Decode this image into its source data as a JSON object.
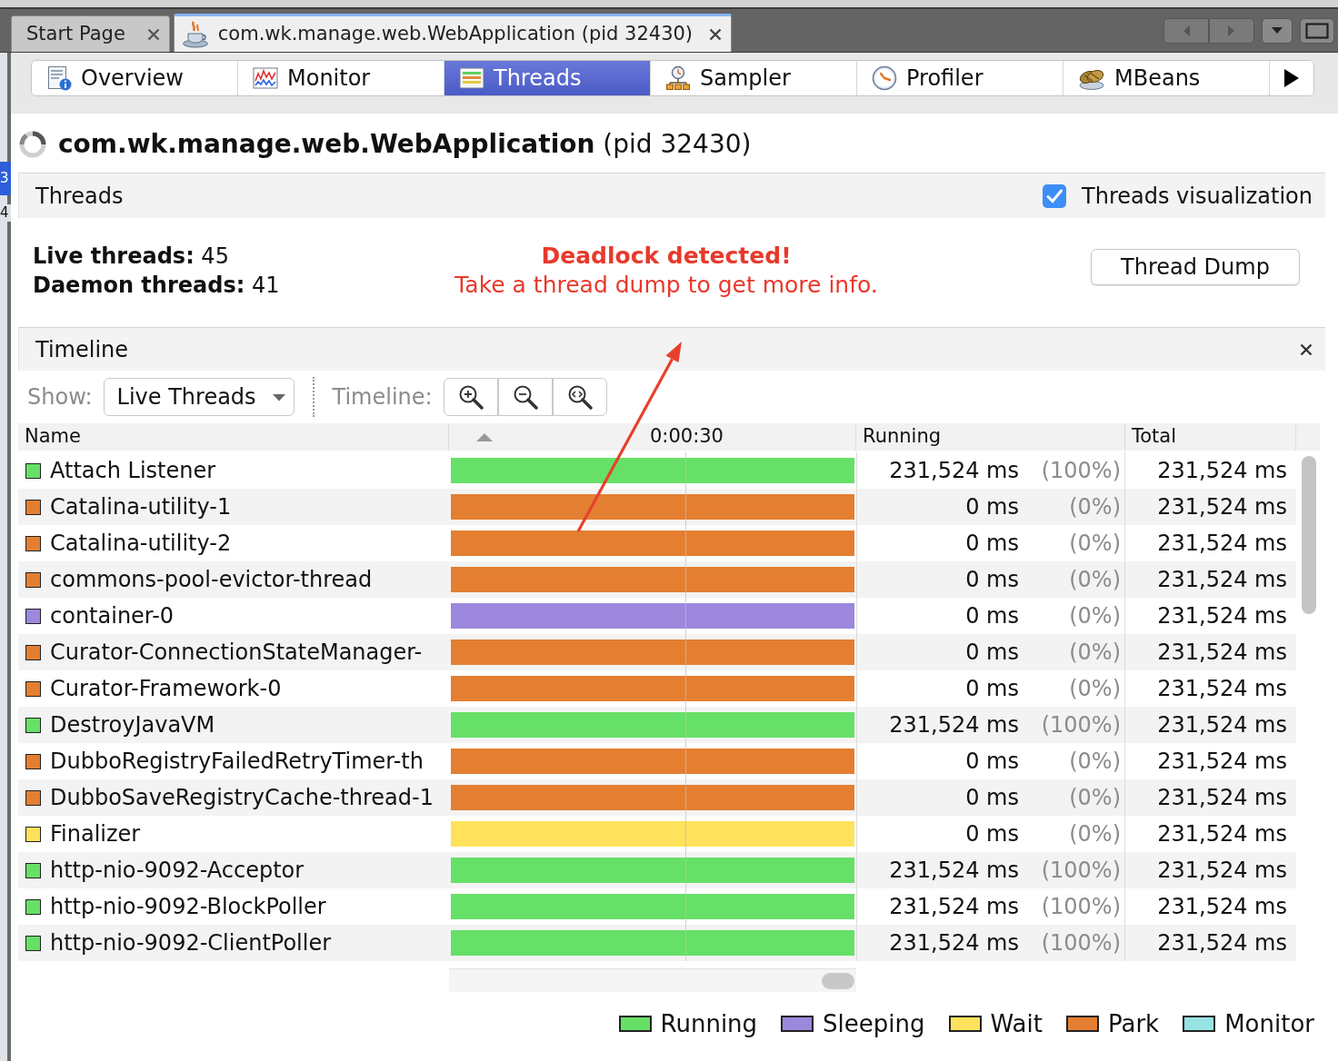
{
  "document_tabs": [
    {
      "label": "Start Page",
      "selected": false
    },
    {
      "label": "com.wk.manage.web.WebApplication (pid 32430)",
      "selected": true
    }
  ],
  "edge_fragment": [
    {
      "text": "3",
      "selected": true
    },
    {
      "text": "4",
      "selected": false
    }
  ],
  "view_tabs": [
    {
      "label": "Overview",
      "selected": false
    },
    {
      "label": "Monitor",
      "selected": false
    },
    {
      "label": "Threads",
      "selected": true
    },
    {
      "label": "Sampler",
      "selected": false
    },
    {
      "label": "Profiler",
      "selected": false
    },
    {
      "label": "MBeans",
      "selected": false
    }
  ],
  "app_title": "**com.wk.manage.web.WebApplication** (pid 32430)",
  "threads_section": {
    "title": "Threads",
    "visualization": {
      "label": "Threads visualization",
      "checked": true
    },
    "stats": [
      "**Live threads:** 45",
      "**Daemon threads:** 41"
    ],
    "alert": {
      "title": "Deadlock detected!",
      "message": "Take a thread dump to get more info."
    },
    "dump_button": "Thread Dump"
  },
  "timeline_section": {
    "title": "Timeline",
    "show_label": "Show:",
    "show_value": "Live Threads",
    "timeline_label": "Timeline:"
  },
  "table": {
    "columns": {
      "name": "Name",
      "timeline_tick": "0:00:30",
      "running": "Running",
      "total": "Total"
    },
    "rows": [
      {
        "name": "Attach Listener",
        "color": "#66e066",
        "running": "231,524 ms",
        "running_share": "(100%)",
        "total": "231,524 ms"
      },
      {
        "name": "Catalina-utility-1",
        "color": "#e47f31",
        "running": "0 ms",
        "running_share": "(0%)",
        "total": "231,524 ms"
      },
      {
        "name": "Catalina-utility-2",
        "color": "#e47f31",
        "running": "0 ms",
        "running_share": "(0%)",
        "total": "231,524 ms"
      },
      {
        "name": "commons-pool-evictor-thread",
        "color": "#e47f31",
        "running": "0 ms",
        "running_share": "(0%)",
        "total": "231,524 ms"
      },
      {
        "name": "container-0",
        "color": "#9c88dc",
        "running": "0 ms",
        "running_share": "(0%)",
        "total": "231,524 ms"
      },
      {
        "name": "Curator-ConnectionStateManager-",
        "color": "#e47f31",
        "running": "0 ms",
        "running_share": "(0%)",
        "total": "231,524 ms"
      },
      {
        "name": "Curator-Framework-0",
        "color": "#e47f31",
        "running": "0 ms",
        "running_share": "(0%)",
        "total": "231,524 ms"
      },
      {
        "name": "DestroyJavaVM",
        "color": "#66e066",
        "running": "231,524 ms",
        "running_share": "(100%)",
        "total": "231,524 ms"
      },
      {
        "name": "DubboRegistryFailedRetryTimer-th",
        "color": "#e47f31",
        "running": "0 ms",
        "running_share": "(0%)",
        "total": "231,524 ms"
      },
      {
        "name": "DubboSaveRegistryCache-thread-1",
        "color": "#e47f31",
        "running": "0 ms",
        "running_share": "(0%)",
        "total": "231,524 ms"
      },
      {
        "name": "Finalizer",
        "color": "#ffe25c",
        "running": "0 ms",
        "running_share": "(0%)",
        "total": "231,524 ms"
      },
      {
        "name": "http-nio-9092-Acceptor",
        "color": "#66e066",
        "running": "231,524 ms",
        "running_share": "(100%)",
        "total": "231,524 ms"
      },
      {
        "name": "http-nio-9092-BlockPoller",
        "color": "#66e066",
        "running": "231,524 ms",
        "running_share": "(100%)",
        "total": "231,524 ms"
      },
      {
        "name": "http-nio-9092-ClientPoller",
        "color": "#66e066",
        "running": "231,524 ms",
        "running_share": "(100%)",
        "total": "231,524 ms"
      }
    ]
  },
  "legend": [
    {
      "label": "Running",
      "color": "#66e066"
    },
    {
      "label": "Sleeping",
      "color": "#9c88dc"
    },
    {
      "label": "Wait",
      "color": "#ffe25c"
    },
    {
      "label": "Park",
      "color": "#e47f31"
    },
    {
      "label": "Monitor",
      "color": "#96e3e3"
    }
  ]
}
